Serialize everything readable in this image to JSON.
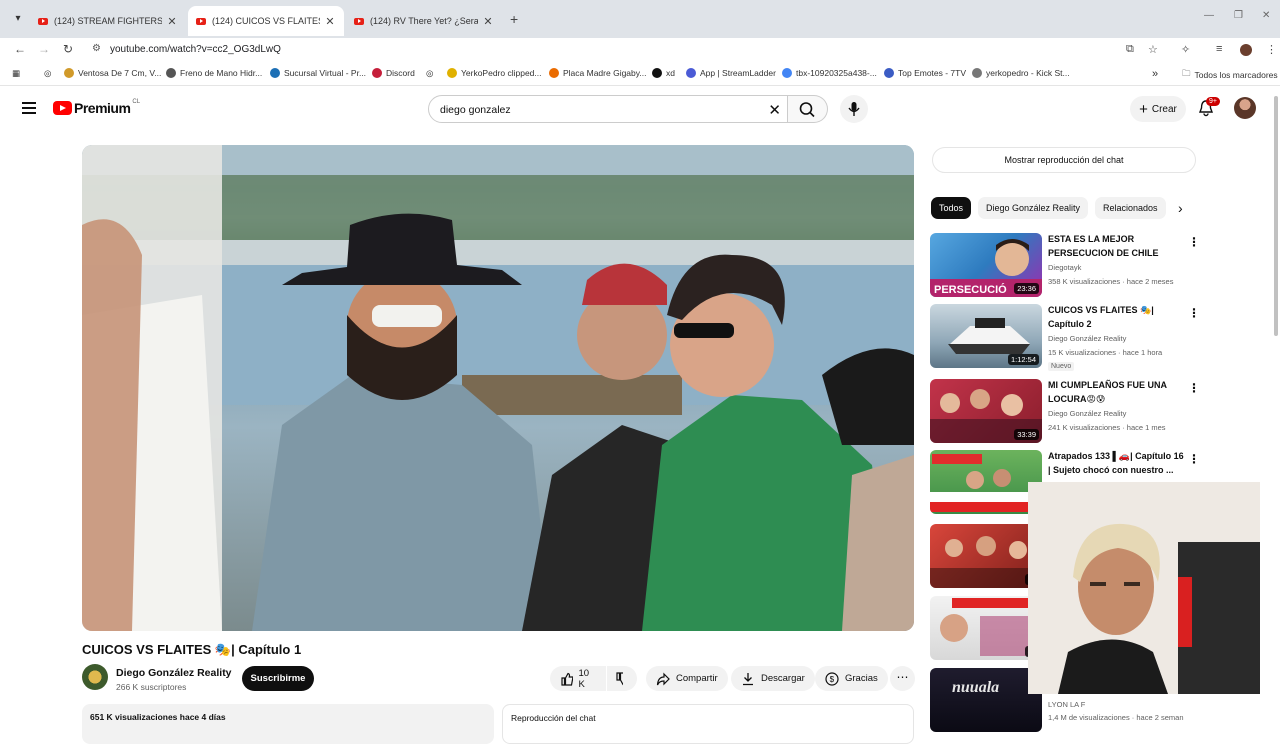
{
  "browser": {
    "tabs": [
      {
        "label": "(124) STREAM FIGHTERS 4 \"DIF",
        "active": false
      },
      {
        "label": "(124) CUICOS VS FLAITES 🎭| Ca",
        "active": true
      },
      {
        "label": "(124) RV There Yet? ¿Sera el nu",
        "active": false
      }
    ],
    "url": "youtube.com/watch?v=cc2_OG3dLwQ",
    "bookmarks": [
      {
        "label": "Ventosa De 7 Cm, V...",
        "color": "#d19a2a"
      },
      {
        "label": "Freno de Mano Hidr...",
        "color": "#555555"
      },
      {
        "label": "Sucursal Virtual - Pr...",
        "color": "#1c6fb5"
      },
      {
        "label": "Discord",
        "color": "#c51e3a"
      },
      {
        "label": "YerkoPedro clipped...",
        "color": "#e0b100"
      },
      {
        "label": "Placa Madre Gigaby...",
        "color": "#ea6b00"
      },
      {
        "label": "xd",
        "color": "#111111"
      },
      {
        "label": "App | StreamLadder",
        "color": "#4b5bd6"
      },
      {
        "label": "tbx-10920325a438-...",
        "color": "#4285f4"
      },
      {
        "label": "Top Emotes - 7TV",
        "color": "#3b5cc4"
      },
      {
        "label": "yerkopedro - Kick St...",
        "color": "#777777"
      }
    ],
    "all_bookmarks": "Todos los marcadores"
  },
  "masthead": {
    "logo": "Premium",
    "country": "CL",
    "search_query": "diego gonzalez",
    "create_label": "Crear",
    "notif_badge": "9+"
  },
  "video": {
    "title": "CUICOS VS FLAITES 🎭| Capítulo 1",
    "channel": "Diego González Reality",
    "subscribers": "266 K suscriptores",
    "subscribe_label": "Suscribirme",
    "likes": "10 K",
    "share_label": "Compartir",
    "download_label": "Descargar",
    "thanks_label": "Gracias",
    "views_date": "651 K visualizaciones  hace 4 días",
    "chat_replay": "Reproducción del chat"
  },
  "sidebar": {
    "show_chat": "Mostrar reproducción del chat",
    "chips": [
      "Todos",
      "Diego González Reality",
      "Relacionados"
    ],
    "items": [
      {
        "title": "ESTA ES LA MEJOR PERSECUCION DE CHILE",
        "channel": "Diegotayk",
        "meta": "358 K visualizaciones · hace 2 meses",
        "duration": "23:36",
        "thumb": "#2e7bbf"
      },
      {
        "title": "CUICOS VS FLAITES 🎭| Capítulo 2",
        "channel": "Diego González Reality",
        "meta": "15 K visualizaciones · hace 1 hora",
        "duration": "1:12:54",
        "badge": "Nuevo",
        "thumb": "#8fa7b7"
      },
      {
        "title": "MI CUMPLEAÑOS FUE UNA LOCURA😡😰",
        "channel": "Diego González Reality",
        "meta": "241 K visualizaciones · hace 1 mes",
        "duration": "33:39",
        "thumb": "#b3243a"
      },
      {
        "title": "Atrapados 133 ▌🚗| Capítulo 16 | Sujeto chocó con nuestro ...",
        "channel": "",
        "meta": "",
        "duration": "",
        "thumb": "#3a8a45"
      },
      {
        "title": "",
        "channel": "",
        "meta": "",
        "duration": "24",
        "thumb": "#c4372f"
      },
      {
        "title": "",
        "channel": "",
        "meta": "",
        "duration": "33",
        "thumb": "#d8d8d8"
      }
    ],
    "bottom_channel": "LYON LA F",
    "bottom_meta": "1,4 M de visualizaciones · hace 2 seman"
  },
  "colors": {
    "accent": "#ff0000",
    "badge": "#cc0000"
  }
}
